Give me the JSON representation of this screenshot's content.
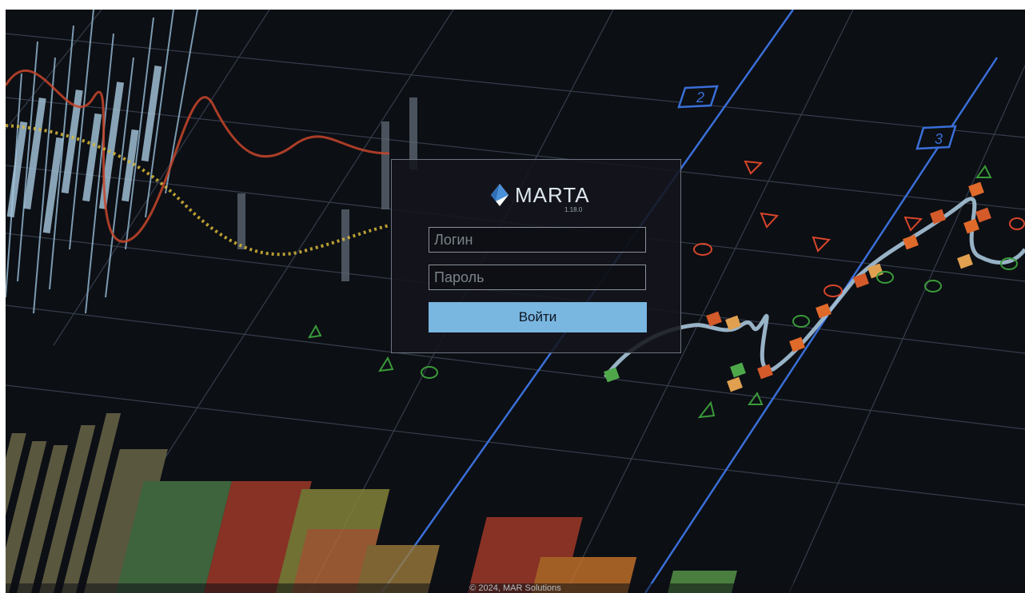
{
  "app": {
    "name": "MARTA",
    "version": "1.18.0"
  },
  "login_form": {
    "login_placeholder": "Логин",
    "login_value": "",
    "password_placeholder": "Пароль",
    "password_value": "",
    "submit_label": "Войти"
  },
  "footer": {
    "copyright": "© 2024, MAR Solutions"
  },
  "background": {
    "chart_markers": [
      "2",
      "3"
    ]
  },
  "icons": {
    "logo": "marta-diamond-logo-icon"
  },
  "colors": {
    "background": "#0c0f14",
    "accent_button": "#79b6e0",
    "grid_blue": "#3a6fd8",
    "logo_blue": "#4a90d9"
  }
}
